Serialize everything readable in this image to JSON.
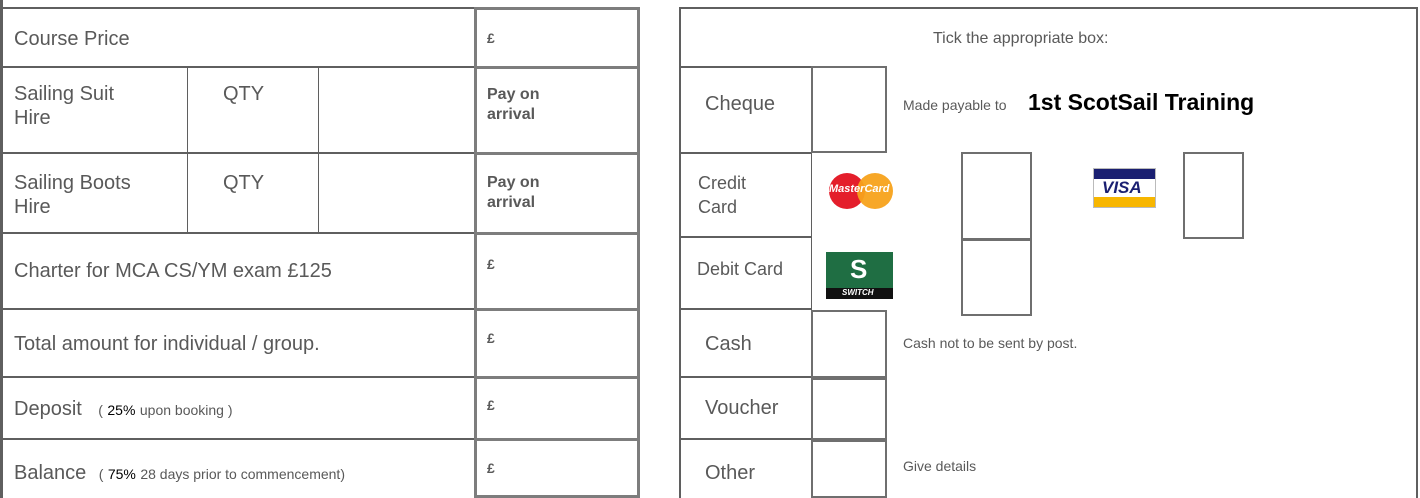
{
  "left": {
    "course_price": {
      "label": "Course Price",
      "value": "£"
    },
    "suit_hire": {
      "label_line1": "Sailing Suit",
      "label_line2": "Hire",
      "qty": "QTY",
      "value_line1": "Pay on",
      "value_line2": "arrival"
    },
    "boots_hire": {
      "label_line1": "Sailing Boots",
      "label_line2": "Hire",
      "qty": "QTY",
      "value_line1": "Pay on",
      "value_line2": "arrival"
    },
    "charter": {
      "label": "Charter for MCA CS/YM exam  £125",
      "value": "£"
    },
    "total": {
      "label": "Total amount for individual / group.",
      "value": "£"
    },
    "deposit": {
      "label": "Deposit",
      "paren_open": "(",
      "pct": "25%",
      "note": "upon booking )",
      "value": "£"
    },
    "balance": {
      "label": "Balance",
      "paren_open": "(",
      "pct": "75%",
      "note": "28 days prior to commencement)",
      "value": "£"
    }
  },
  "right": {
    "instruction": "Tick the appropriate box:",
    "cheque": {
      "label": "Cheque",
      "note": "Made payable to",
      "payee": "1st ScotSail Training"
    },
    "credit_card": {
      "label_line1": "Credit",
      "label_line2": "Card",
      "mastercard": "MasterCard",
      "visa": "VISA"
    },
    "debit_card": {
      "label": "Debit Card",
      "switch": "SWITCH"
    },
    "cash": {
      "label": "Cash",
      "note": "Cash not to be sent by post."
    },
    "voucher": {
      "label": "Voucher"
    },
    "other": {
      "label": "Other",
      "note": "Give details"
    }
  },
  "colors": {
    "border": "#5f5f5f",
    "text": "#595959",
    "mastercard_red": "#e41e2b",
    "mastercard_orange": "#f7a21b",
    "visa_blue": "#1a1f71",
    "visa_gold": "#f7b600",
    "switch_green": "#1f6e43"
  }
}
